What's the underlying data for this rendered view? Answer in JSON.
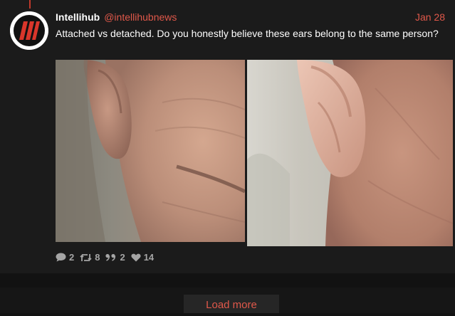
{
  "post": {
    "display_name": "Intellihub",
    "handle": "@intellihubnews",
    "date": "Jan 28",
    "text": "Attached vs detached. Do you honestly believe these ears belong to the same person?",
    "avatar_icon": "intellihub-logo-icon",
    "media": [
      {
        "name": "ear-photo-attached",
        "description_icon": "photo-left"
      },
      {
        "name": "ear-photo-detached",
        "description_icon": "photo-right"
      }
    ],
    "actions": {
      "replies": "2",
      "retweets": "8",
      "quotes": "2",
      "likes": "14"
    }
  },
  "load_more": {
    "label": "Load more"
  },
  "colors": {
    "accent": "#e0584a",
    "background": "#1b1b1b",
    "text": "#ffffff",
    "muted": "#a5a5a5"
  }
}
